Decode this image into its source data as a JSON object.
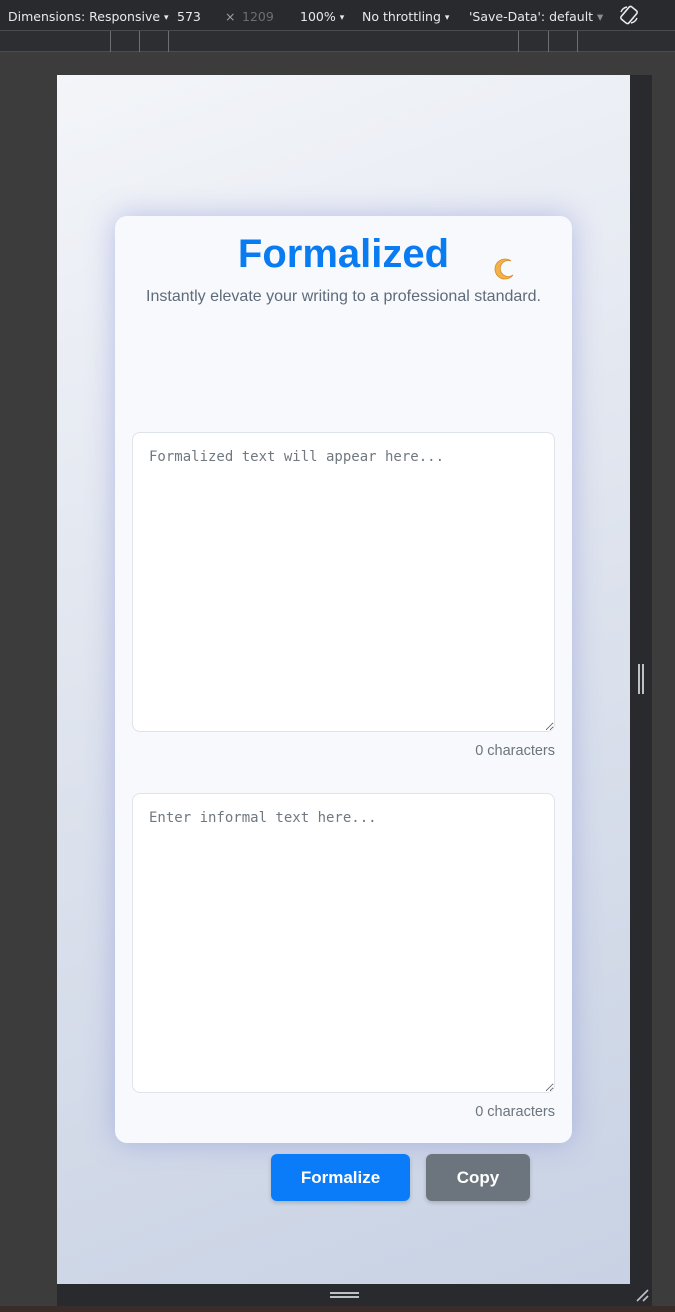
{
  "devtools": {
    "dimensions_label": "Dimensions: Responsive",
    "width": "573",
    "times": "×",
    "height": "1209",
    "zoom": "100%",
    "throttling": "No throttling",
    "save_data": "'Save-Data': default",
    "caret": "▾",
    "icons": [
      "rotate-icon",
      "resize-handle-icon"
    ]
  },
  "app": {
    "title": "Formalized",
    "theme_toggle_icon": "crescent-moon-icon",
    "subtitle": "Instantly elevate your writing to a professional standard.",
    "output": {
      "placeholder": "Formalized text will appear here...",
      "char_count": "0 characters"
    },
    "input": {
      "placeholder": "Enter informal text here...",
      "char_count": "0 characters"
    },
    "buttons": {
      "formalize": "Formalize",
      "copy": "Copy"
    },
    "colors": {
      "accent": "#0a7cf2",
      "formalize_button": "#0a7cfa",
      "copy_button": "#6c757d"
    }
  }
}
